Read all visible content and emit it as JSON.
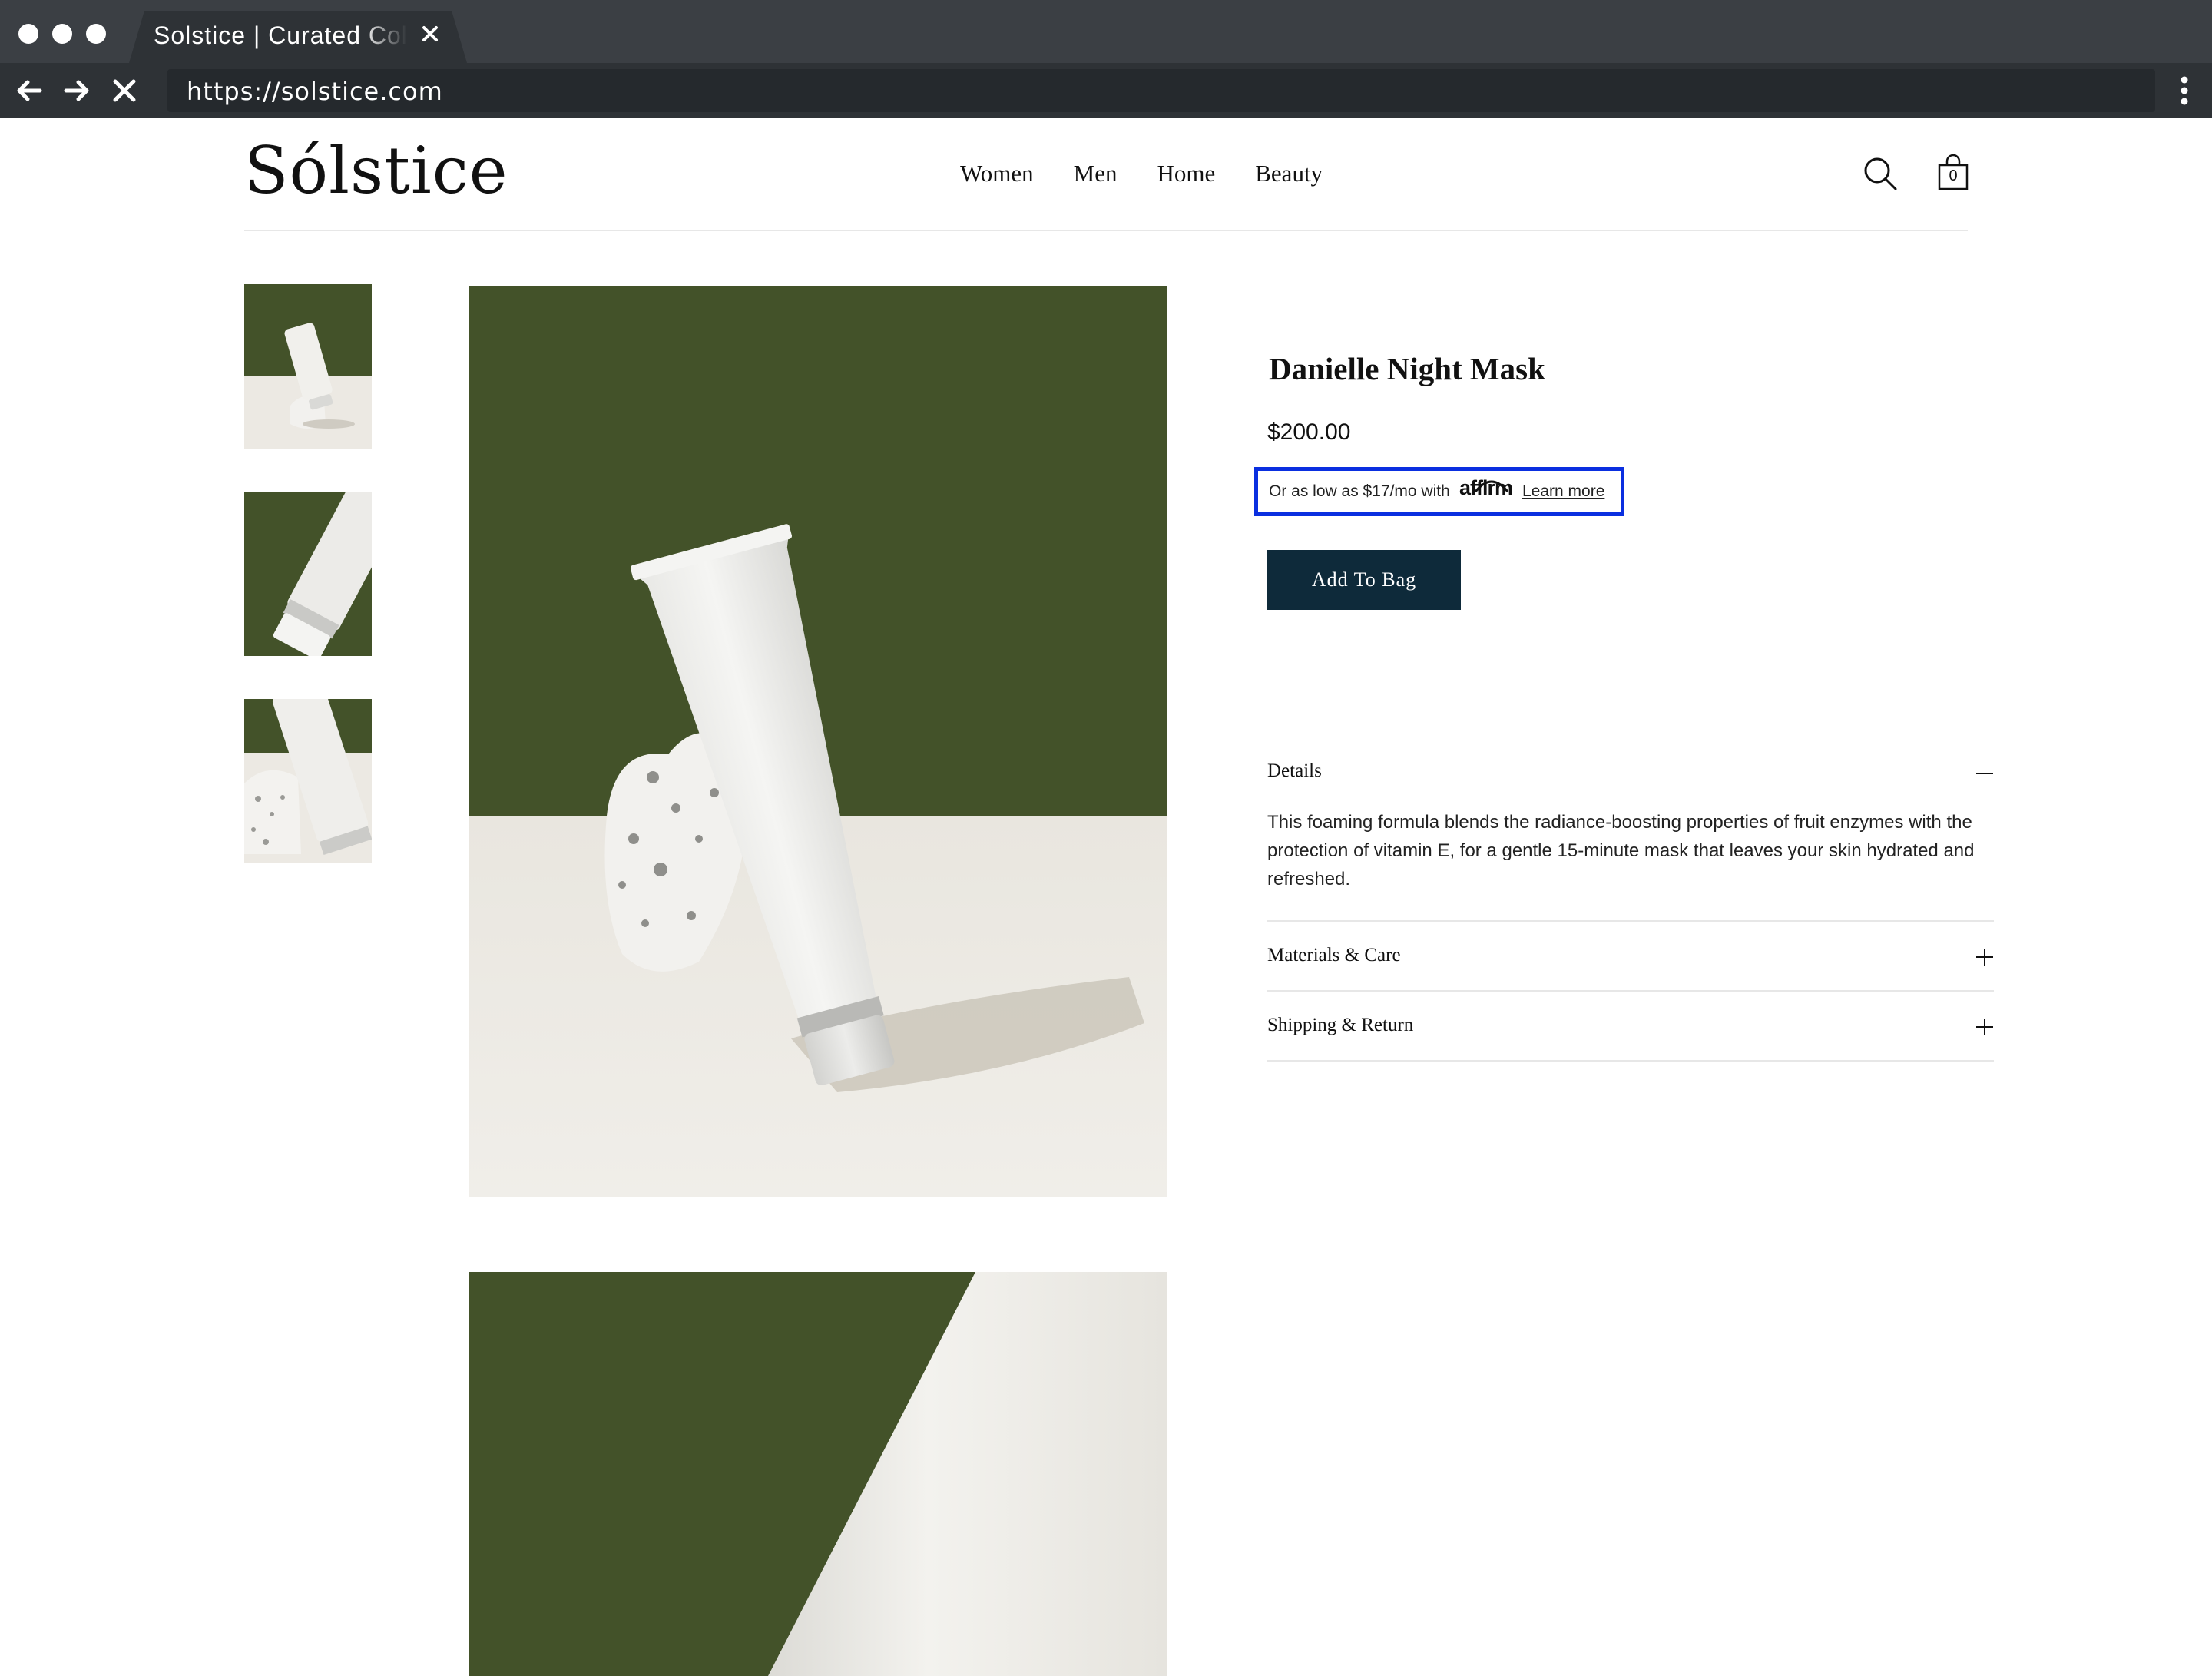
{
  "browser": {
    "tab_title": "Solstice | Curated Collection",
    "url": "https://solstice.com"
  },
  "header": {
    "logo": "Sólstice",
    "nav": [
      "Women",
      "Men",
      "Home",
      "Beauty"
    ],
    "cart_count": "0"
  },
  "product": {
    "title": "Danielle Night Mask",
    "price": "$200.00",
    "affirm": {
      "prefix": "Or as low as $17/mo with",
      "brand": "affirm",
      "link": "Learn more"
    },
    "add_button": "Add To Bag"
  },
  "accordion": [
    {
      "label": "Details",
      "expanded": true,
      "body": "This foaming formula blends the radiance-boosting properties of fruit enzymes with the protection of vitamin E, for a gentle 15-minute mask that leaves your skin hydrated and refreshed."
    },
    {
      "label": "Materials & Care",
      "expanded": false
    },
    {
      "label": "Shipping & Return",
      "expanded": false
    }
  ],
  "colors": {
    "accent_button": "#0e2a3a",
    "highlight_border": "#0a2fe0",
    "backdrop_green": "#435229",
    "surface_cream": "#ece9e3"
  }
}
